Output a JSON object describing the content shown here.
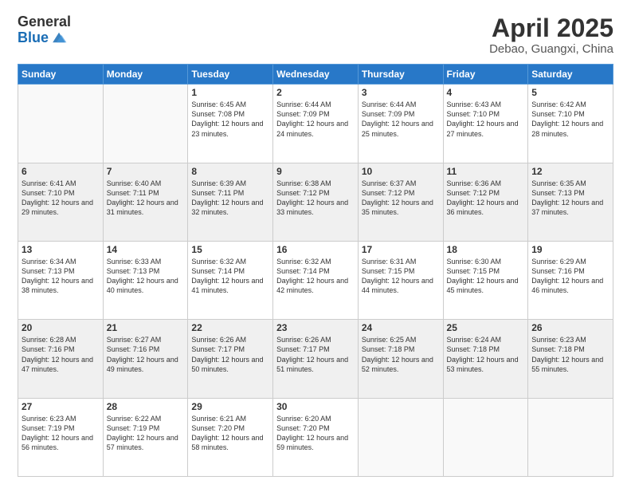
{
  "logo": {
    "general": "General",
    "blue": "Blue"
  },
  "header": {
    "month": "April 2025",
    "location": "Debao, Guangxi, China"
  },
  "weekdays": [
    "Sunday",
    "Monday",
    "Tuesday",
    "Wednesday",
    "Thursday",
    "Friday",
    "Saturday"
  ],
  "weeks": [
    [
      {
        "day": "",
        "sunrise": "",
        "sunset": "",
        "daylight": ""
      },
      {
        "day": "",
        "sunrise": "",
        "sunset": "",
        "daylight": ""
      },
      {
        "day": "1",
        "sunrise": "Sunrise: 6:45 AM",
        "sunset": "Sunset: 7:08 PM",
        "daylight": "Daylight: 12 hours and 23 minutes."
      },
      {
        "day": "2",
        "sunrise": "Sunrise: 6:44 AM",
        "sunset": "Sunset: 7:09 PM",
        "daylight": "Daylight: 12 hours and 24 minutes."
      },
      {
        "day": "3",
        "sunrise": "Sunrise: 6:44 AM",
        "sunset": "Sunset: 7:09 PM",
        "daylight": "Daylight: 12 hours and 25 minutes."
      },
      {
        "day": "4",
        "sunrise": "Sunrise: 6:43 AM",
        "sunset": "Sunset: 7:10 PM",
        "daylight": "Daylight: 12 hours and 27 minutes."
      },
      {
        "day": "5",
        "sunrise": "Sunrise: 6:42 AM",
        "sunset": "Sunset: 7:10 PM",
        "daylight": "Daylight: 12 hours and 28 minutes."
      }
    ],
    [
      {
        "day": "6",
        "sunrise": "Sunrise: 6:41 AM",
        "sunset": "Sunset: 7:10 PM",
        "daylight": "Daylight: 12 hours and 29 minutes."
      },
      {
        "day": "7",
        "sunrise": "Sunrise: 6:40 AM",
        "sunset": "Sunset: 7:11 PM",
        "daylight": "Daylight: 12 hours and 31 minutes."
      },
      {
        "day": "8",
        "sunrise": "Sunrise: 6:39 AM",
        "sunset": "Sunset: 7:11 PM",
        "daylight": "Daylight: 12 hours and 32 minutes."
      },
      {
        "day": "9",
        "sunrise": "Sunrise: 6:38 AM",
        "sunset": "Sunset: 7:12 PM",
        "daylight": "Daylight: 12 hours and 33 minutes."
      },
      {
        "day": "10",
        "sunrise": "Sunrise: 6:37 AM",
        "sunset": "Sunset: 7:12 PM",
        "daylight": "Daylight: 12 hours and 35 minutes."
      },
      {
        "day": "11",
        "sunrise": "Sunrise: 6:36 AM",
        "sunset": "Sunset: 7:12 PM",
        "daylight": "Daylight: 12 hours and 36 minutes."
      },
      {
        "day": "12",
        "sunrise": "Sunrise: 6:35 AM",
        "sunset": "Sunset: 7:13 PM",
        "daylight": "Daylight: 12 hours and 37 minutes."
      }
    ],
    [
      {
        "day": "13",
        "sunrise": "Sunrise: 6:34 AM",
        "sunset": "Sunset: 7:13 PM",
        "daylight": "Daylight: 12 hours and 38 minutes."
      },
      {
        "day": "14",
        "sunrise": "Sunrise: 6:33 AM",
        "sunset": "Sunset: 7:13 PM",
        "daylight": "Daylight: 12 hours and 40 minutes."
      },
      {
        "day": "15",
        "sunrise": "Sunrise: 6:32 AM",
        "sunset": "Sunset: 7:14 PM",
        "daylight": "Daylight: 12 hours and 41 minutes."
      },
      {
        "day": "16",
        "sunrise": "Sunrise: 6:32 AM",
        "sunset": "Sunset: 7:14 PM",
        "daylight": "Daylight: 12 hours and 42 minutes."
      },
      {
        "day": "17",
        "sunrise": "Sunrise: 6:31 AM",
        "sunset": "Sunset: 7:15 PM",
        "daylight": "Daylight: 12 hours and 44 minutes."
      },
      {
        "day": "18",
        "sunrise": "Sunrise: 6:30 AM",
        "sunset": "Sunset: 7:15 PM",
        "daylight": "Daylight: 12 hours and 45 minutes."
      },
      {
        "day": "19",
        "sunrise": "Sunrise: 6:29 AM",
        "sunset": "Sunset: 7:16 PM",
        "daylight": "Daylight: 12 hours and 46 minutes."
      }
    ],
    [
      {
        "day": "20",
        "sunrise": "Sunrise: 6:28 AM",
        "sunset": "Sunset: 7:16 PM",
        "daylight": "Daylight: 12 hours and 47 minutes."
      },
      {
        "day": "21",
        "sunrise": "Sunrise: 6:27 AM",
        "sunset": "Sunset: 7:16 PM",
        "daylight": "Daylight: 12 hours and 49 minutes."
      },
      {
        "day": "22",
        "sunrise": "Sunrise: 6:26 AM",
        "sunset": "Sunset: 7:17 PM",
        "daylight": "Daylight: 12 hours and 50 minutes."
      },
      {
        "day": "23",
        "sunrise": "Sunrise: 6:26 AM",
        "sunset": "Sunset: 7:17 PM",
        "daylight": "Daylight: 12 hours and 51 minutes."
      },
      {
        "day": "24",
        "sunrise": "Sunrise: 6:25 AM",
        "sunset": "Sunset: 7:18 PM",
        "daylight": "Daylight: 12 hours and 52 minutes."
      },
      {
        "day": "25",
        "sunrise": "Sunrise: 6:24 AM",
        "sunset": "Sunset: 7:18 PM",
        "daylight": "Daylight: 12 hours and 53 minutes."
      },
      {
        "day": "26",
        "sunrise": "Sunrise: 6:23 AM",
        "sunset": "Sunset: 7:18 PM",
        "daylight": "Daylight: 12 hours and 55 minutes."
      }
    ],
    [
      {
        "day": "27",
        "sunrise": "Sunrise: 6:23 AM",
        "sunset": "Sunset: 7:19 PM",
        "daylight": "Daylight: 12 hours and 56 minutes."
      },
      {
        "day": "28",
        "sunrise": "Sunrise: 6:22 AM",
        "sunset": "Sunset: 7:19 PM",
        "daylight": "Daylight: 12 hours and 57 minutes."
      },
      {
        "day": "29",
        "sunrise": "Sunrise: 6:21 AM",
        "sunset": "Sunset: 7:20 PM",
        "daylight": "Daylight: 12 hours and 58 minutes."
      },
      {
        "day": "30",
        "sunrise": "Sunrise: 6:20 AM",
        "sunset": "Sunset: 7:20 PM",
        "daylight": "Daylight: 12 hours and 59 minutes."
      },
      {
        "day": "",
        "sunrise": "",
        "sunset": "",
        "daylight": ""
      },
      {
        "day": "",
        "sunrise": "",
        "sunset": "",
        "daylight": ""
      },
      {
        "day": "",
        "sunrise": "",
        "sunset": "",
        "daylight": ""
      }
    ]
  ]
}
